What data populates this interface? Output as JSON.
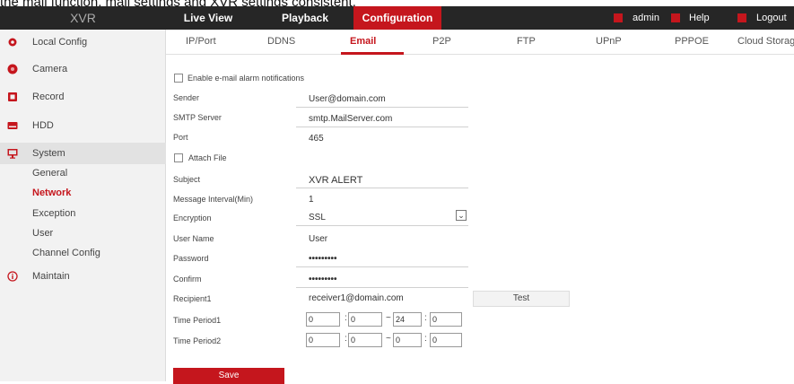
{
  "caption": "the mail function, mail settings and XVR settings consistent.",
  "header": {
    "brand": "XVR",
    "nav": [
      {
        "label": "Live View"
      },
      {
        "label": "Playback"
      },
      {
        "label": "Configuration"
      }
    ],
    "user": "admin",
    "help": "Help",
    "logout": "Logout"
  },
  "sidebar": {
    "items": [
      {
        "label": "Local Config",
        "icon": "gear-icon"
      },
      {
        "label": "Camera",
        "icon": "camera-icon"
      },
      {
        "label": "Record",
        "icon": "record-icon"
      },
      {
        "label": "HDD",
        "icon": "hdd-icon"
      },
      {
        "label": "System",
        "icon": "monitor-icon"
      },
      {
        "label": "Maintain",
        "icon": "info-icon"
      }
    ],
    "system_sub": [
      "General",
      "Network",
      "Exception",
      "User",
      "Channel Config"
    ],
    "active_sub": "Network"
  },
  "tabs": [
    "IP/Port",
    "DDNS",
    "Email",
    "P2P",
    "FTP",
    "UPnP",
    "PPPOE",
    "Cloud Storage"
  ],
  "active_tab": "Email",
  "form": {
    "enable_label": "Enable e-mail alarm notifications",
    "sender_label": "Sender",
    "sender": "User@domain.com",
    "smtp_label": "SMTP Server",
    "smtp": "smtp.MailServer.com",
    "port_label": "Port",
    "port": "465",
    "attach_label": "Attach File",
    "subject_label": "Subject",
    "subject": "XVR ALERT",
    "interval_label": "Message Interval(Min)",
    "interval": "1",
    "encryption_label": "Encryption",
    "encryption": "SSL",
    "username_label": "User Name",
    "username": "User",
    "password_label": "Password",
    "password": "•••••••••",
    "confirm_label": "Confirm",
    "confirm": "•••••••••",
    "recipient_label": "Recipient1",
    "recipient": "receiver1@domain.com",
    "test_label": "Test",
    "tp1_label": "Time Period1",
    "tp1": [
      "0",
      "0",
      "24",
      "0"
    ],
    "tp2_label": "Time Period2",
    "tp2": [
      "0",
      "0",
      "0",
      "0"
    ],
    "save_label": "Save"
  },
  "colors": {
    "accent": "#c5161d",
    "topbar": "#262626",
    "sidebar": "#f2f2f2"
  }
}
